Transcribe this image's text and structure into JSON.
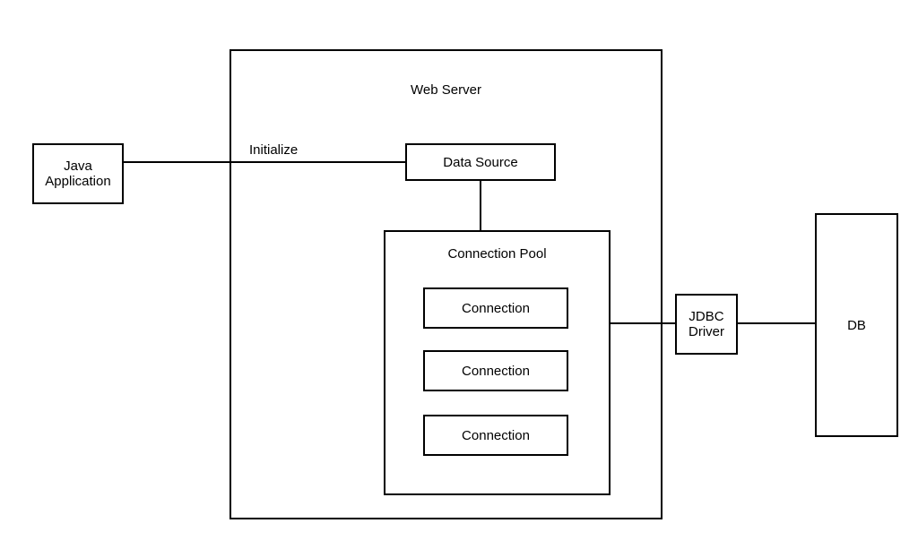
{
  "diagram": {
    "javaApp": "Java\nApplication",
    "initialize": "Initialize",
    "webServer": "Web Server",
    "dataSource": "Data Source",
    "connectionPool": "Connection Pool",
    "connections": [
      "Connection",
      "Connection",
      "Connection"
    ],
    "jdbcDriver": "JDBC\nDriver",
    "db": "DB"
  }
}
